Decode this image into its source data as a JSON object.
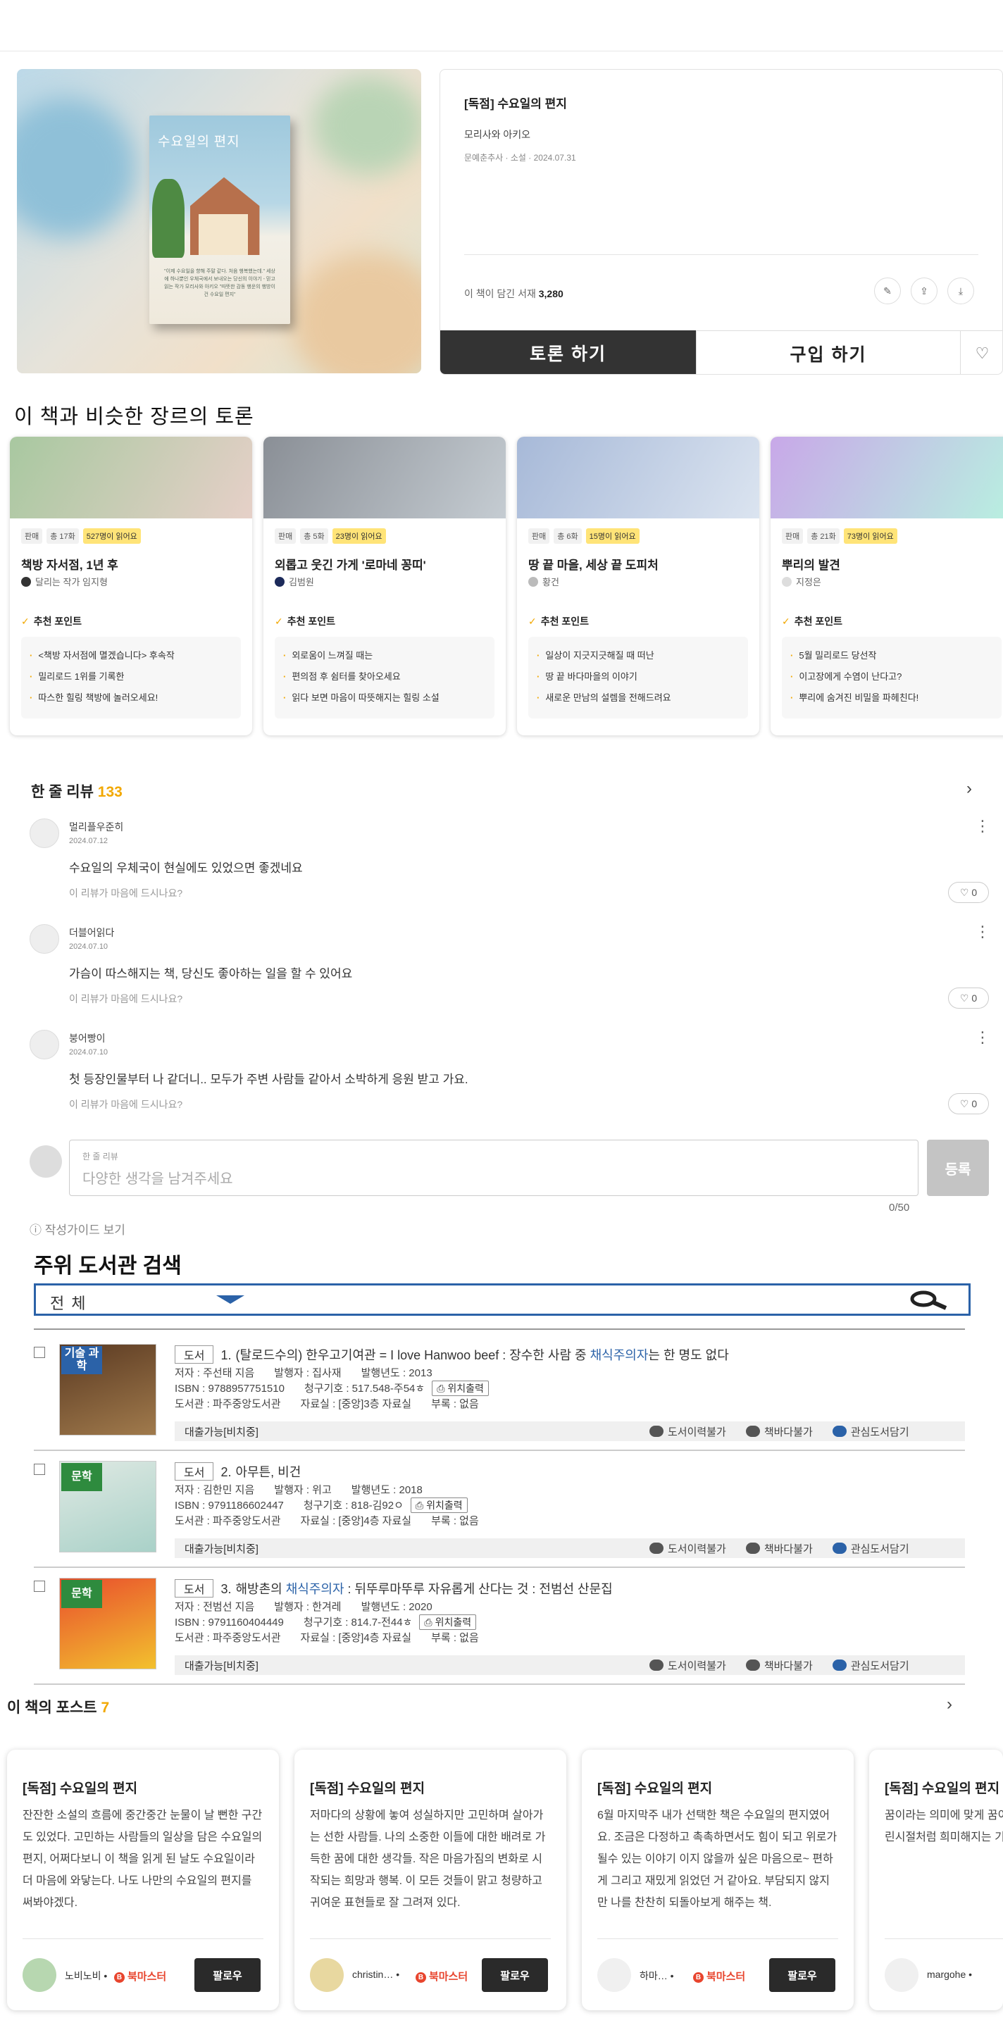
{
  "book": {
    "cover_title": "수요일의 편지",
    "cover_note": "\"이제 수요일을 향해 주말 같다. 처음 행복했는데.\" 세상에 하나뿐인 우체국에서 보내오는 당신의 이야기 - 믿고 읽는 작가 모리사와 아키오 \"따뜻한 감동 행운의 행방이 건 수요일 편지\"",
    "title": "[독점] 수요일의 편지",
    "author": "모리사와 아키오",
    "meta": "문예춘추사 · 소설 · 2024.07.31",
    "shelf_label": "이 책이 담긴 서재",
    "shelf_count": "3,280",
    "discuss_btn": "토론 하기",
    "buy_btn": "구입 하기"
  },
  "similar": {
    "title": "이 책과 비슷한 장르의 토론",
    "cards": [
      {
        "tag1": "판매",
        "tag2": "총 17화",
        "tag3": "527명이 읽어요",
        "title": "책방 자서점, 1년 후",
        "user": "달리는 작가 임지형",
        "point": "추천 포인트",
        "bullets": [
          "<책방 자서점에 멸겠습니다> 후속작",
          "밀리로드 1위를 기록한",
          "따스한 힐링 책방에 놀러오세요!"
        ],
        "c1": "#a8c8a0",
        "c2": "#e6d0c8",
        "av": "#333"
      },
      {
        "tag1": "판매",
        "tag2": "총 5화",
        "tag3": "23명이 읽어요",
        "title": "외롭고 웃긴 가게 '로마네 꽁띠'",
        "user": "김범원",
        "point": "추천 포인트",
        "bullets": [
          "외로움이 느껴질 때는",
          "편의점 후 쉼터를 찾아오세요",
          "읽다 보면 마음이 따뜻해지는 힐링 소설"
        ],
        "c1": "#8a8f96",
        "c2": "#c5ccd2",
        "av": "#1c2a5a"
      },
      {
        "tag1": "판매",
        "tag2": "총 6화",
        "tag3": "15명이 읽어요",
        "title": "땅 끝 마을, 세상 끝 도피처",
        "user": "황건",
        "point": "추천 포인트",
        "bullets": [
          "일상이 지긋지긋해질 때 떠난",
          "땅 끝 바다마을의 이야기",
          "새로운 만남의 설렘을 전해드려요"
        ],
        "c1": "#a7b9d8",
        "c2": "#dbe4f0",
        "av": "#bbb"
      },
      {
        "tag1": "판매",
        "tag2": "총 21화",
        "tag3": "73명이 읽어요",
        "title": "뿌리의 발견",
        "user": "지정은",
        "point": "추천 포인트",
        "bullets": [
          "5월 밀리로드 당선작",
          "이고장에게 수염이 난다고?",
          "뿌리에 숨겨진 비밀을 파헤친다!"
        ],
        "c1": "#c8a8e8",
        "c2": "#b8f0e0",
        "av": "#ddd"
      }
    ]
  },
  "reviews": {
    "title": "한 줄 리뷰",
    "count": "133",
    "items": [
      {
        "name": "멀리플우준히",
        "date": "2024.07.12",
        "text": "수요일의 우체국이 현실에도 있었으면 좋겠네요",
        "ask": "이 리뷰가 마음에 드시나요?",
        "likes": "0"
      },
      {
        "name": "더블어읽다",
        "date": "2024.07.10",
        "text": "가슴이 따스해지는 책, 당신도 좋아하는 일을 할 수 있어요",
        "ask": "이 리뷰가 마음에 드시나요?",
        "likes": "0"
      },
      {
        "name": "붕어빵이",
        "date": "2024.07.10",
        "text": "첫 등장인물부터 나 같더니.. 모두가 주변 사람들 같아서 소박하게 응원 받고 가요.",
        "ask": "이 리뷰가 마음에 드시나요?",
        "likes": "0"
      }
    ],
    "input_label": "한 줄 리뷰",
    "input_placeholder": "다양한 생각을 남겨주세요",
    "submit": "등록",
    "counter": "0/50",
    "guide": "작성가이드 보기"
  },
  "library": {
    "title": "주위 도서관 검색",
    "select": "전체",
    "items": [
      {
        "kind": "도서",
        "num": "1.",
        "title_a": "(탈로드수의) 한우고기여관 = I love Hanwoo beef : 장수한 사람 중 ",
        "kw": "채식주의자",
        "title_b": "는 한 명도 없다",
        "author": "저자 : 주선태 지음",
        "pub": "발행자 : 집사재",
        "year": "발행년도 : 2013",
        "isbn": "ISBN : 9788957751510",
        "call": "청구기호 : 517.548-주54ㅎ",
        "loc_btn": "위치출력",
        "lib": "도서관 : 파주중앙도서관",
        "room": "자료실 : [중앙]3층 자료실",
        "ap": "부록 : 없음",
        "avail": "대출가능[비치중]",
        "badge": "기술\n과학",
        "badge_color": "#2b62a8",
        "c1": "#5b3a22",
        "c2": "#a07a4c"
      },
      {
        "kind": "도서",
        "num": "2.",
        "title_a": "아무튼, 비건",
        "kw": "",
        "title_b": "",
        "author": "저자 : 김한민 지음",
        "pub": "발행자 : 위고",
        "year": "발행년도 : 2018",
        "isbn": "ISBN : 9791186602447",
        "call": "청구기호 : 818-김92ㅇ",
        "loc_btn": "위치출력",
        "lib": "도서관 : 파주중앙도서관",
        "room": "자료실 : [중앙]4층 자료실",
        "ap": "부록 : 없음",
        "avail": "대출가능[비치중]",
        "badge": "문학",
        "badge_color": "#2e8b3e",
        "c1": "#dfe9e3",
        "c2": "#a9d1c8"
      },
      {
        "kind": "도서",
        "num": "3.",
        "title_a": "해방촌의 ",
        "kw": "채식주의자",
        "title_b": " : 뒤뚜루마뚜루 자유롭게 산다는 것 : 전범선 산문집",
        "author": "저자 : 전범선 지음",
        "pub": "발행자 : 한겨레",
        "year": "발행년도 : 2020",
        "isbn": "ISBN : 9791160404449",
        "call": "청구기호 : 814.7-전44ㅎ",
        "loc_btn": "위치출력",
        "lib": "도서관 : 파주중앙도서관",
        "room": "자료실 : [중앙]4층 자료실",
        "ap": "부록 : 없음",
        "avail": "대출가능[비치중]",
        "badge": "문학",
        "badge_color": "#2e8b3e",
        "c1": "#e94d2d",
        "c2": "#f2c12e"
      }
    ],
    "act_borrow": "도서이력불가",
    "act_ill": "책바다불가",
    "act_fav": "관심도서담기"
  },
  "posts": {
    "title": "이 책의 포스트",
    "count": "7",
    "follow": "팔로우",
    "badge": "북마스터",
    "items": [
      {
        "title": "[독점] 수요일의 편지",
        "body": "잔잔한 소설의 흐름에 중간중간 눈물이 날 뻔한 구간도 있었다. 고민하는 사람들의 일상을 담은 수요일의 편지, 어쩌다보니 이 책을 읽게 된 날도 수요일이라 더 마음에 와닿는다. 나도 나만의 수요일의 편지를 써봐야겠다.",
        "name": "노비노비 •",
        "av": "#b7d7b0"
      },
      {
        "title": "[독점] 수요일의 편지",
        "body": "저마다의 상황에 놓여 성실하지만 고민하며 살아가는 선한 사람들. 나의 소중한 이들에 대한 배려로 가득한 꿈에 대한 생각들. 작은 마음가짐의 변화로 시작되는 희망과 행복. 이 모든 것들이 맑고 청량하고 귀여운 표현들로 잘 그려져 있다.",
        "name": "christin… •",
        "av": "#e8d8a0"
      },
      {
        "title": "[독점] 수요일의 편지",
        "body": "6월 마지막주 내가 선택한 책은 수요일의 편지였어요. 조금은 다정하고 촉촉하면서도 힘이 되고 위로가 될수 있는 이야기 이지 않을까 싶은 마음으로~ 편하게 그리고 재밌게 읽었던 거 같아요. 부담되지 않지만 나를 찬찬히 되돌아보게 해주는 책.",
        "name": "하마… •",
        "av": "#f0f0f0"
      },
      {
        "title": "[독점] 수요일의 편지",
        "body": "꿈이라는 의미에 맞게 꿈이 되었지만 꿈을 소재로 어린시절처럼 희미해지는 기분이 들었다",
        "name": "margohe •",
        "av": "#f0f0f0"
      }
    ]
  }
}
